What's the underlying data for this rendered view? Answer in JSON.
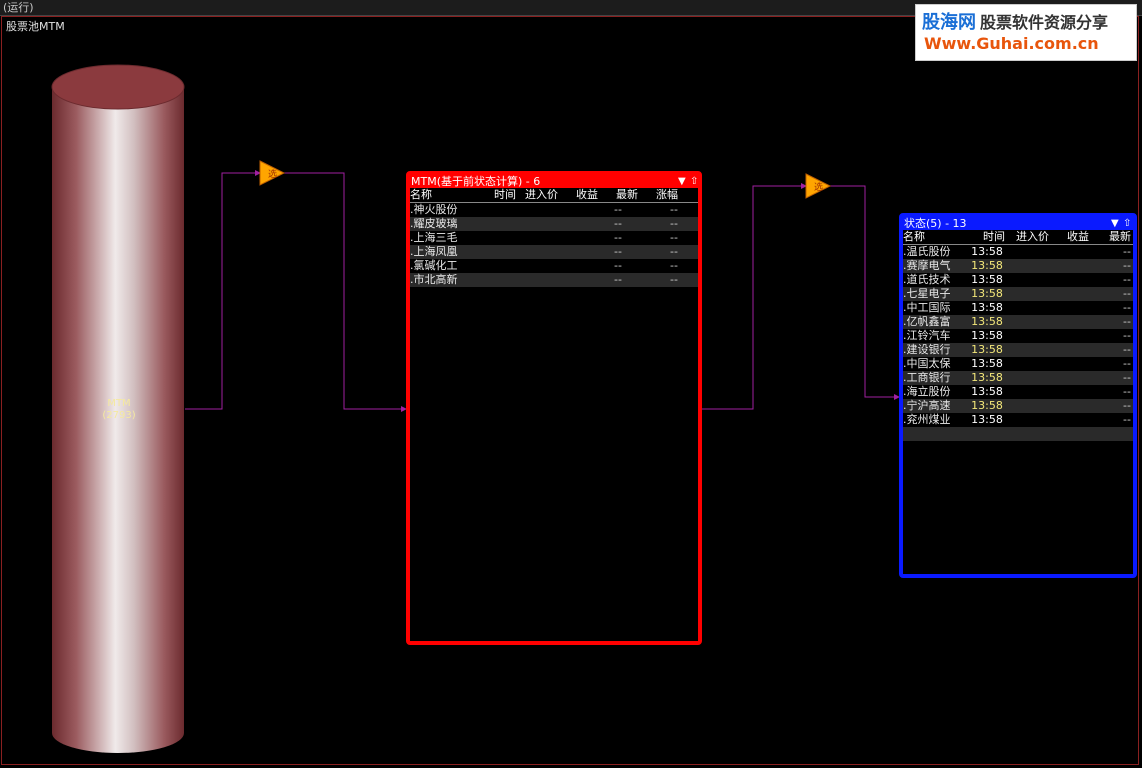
{
  "window": {
    "title": "(运行)"
  },
  "pool": {
    "label": "股票池MTM"
  },
  "logo": {
    "brand": "股海网",
    "slogan": "股票软件资源分享",
    "url": "Www.Guhai.com.cn"
  },
  "colors": {
    "red_panel": "#ff0000",
    "blue_panel": "#0a1aff",
    "wire": "#a020a0",
    "cylinder": "#8b3a3e",
    "filter_icon": "#ffa500"
  },
  "cylinder": {
    "name": "MTM",
    "count": "(2793)"
  },
  "filter_icon_text": "选",
  "panel_red": {
    "title": "MTM(基于前状态计算) - 6",
    "columns": [
      "名称",
      "时间",
      "进入价",
      "收益",
      "最新",
      "涨幅"
    ],
    "rows": [
      {
        "name": ".神火股份",
        "time": "",
        "price": "",
        "gain": "",
        "latest": "--",
        "change": "--"
      },
      {
        "name": ".耀皮玻璃",
        "time": "",
        "price": "",
        "gain": "",
        "latest": "--",
        "change": "--"
      },
      {
        "name": ".上海三毛",
        "time": "",
        "price": "",
        "gain": "",
        "latest": "--",
        "change": "--"
      },
      {
        "name": ".上海凤凰",
        "time": "",
        "price": "",
        "gain": "",
        "latest": "--",
        "change": "--"
      },
      {
        "name": ".氯碱化工",
        "time": "",
        "price": "",
        "gain": "",
        "latest": "--",
        "change": "--"
      },
      {
        "name": ".市北高新",
        "time": "",
        "price": "",
        "gain": "",
        "latest": "--",
        "change": "--"
      }
    ]
  },
  "panel_blue": {
    "title": "状态(5) - 13",
    "columns": [
      "名称",
      "时间",
      "进入价",
      "收益",
      "最新"
    ],
    "rows": [
      {
        "name": ".温氏股份",
        "time": "13:58",
        "price": "",
        "gain": "",
        "latest": "--"
      },
      {
        "name": ".赛摩电气",
        "time": "13:58",
        "price": "",
        "gain": "",
        "latest": "--"
      },
      {
        "name": ".道氏技术",
        "time": "13:58",
        "price": "",
        "gain": "",
        "latest": "--"
      },
      {
        "name": ".七星电子",
        "time": "13:58",
        "price": "",
        "gain": "",
        "latest": "--"
      },
      {
        "name": ".中工国际",
        "time": "13:58",
        "price": "",
        "gain": "",
        "latest": "--"
      },
      {
        "name": ".亿帆鑫富",
        "time": "13:58",
        "price": "",
        "gain": "",
        "latest": "--"
      },
      {
        "name": ".江铃汽车",
        "time": "13:58",
        "price": "",
        "gain": "",
        "latest": "--"
      },
      {
        "name": ".建设银行",
        "time": "13:58",
        "price": "",
        "gain": "",
        "latest": "--"
      },
      {
        "name": ".中国太保",
        "time": "13:58",
        "price": "",
        "gain": "",
        "latest": "--"
      },
      {
        "name": ".工商银行",
        "time": "13:58",
        "price": "",
        "gain": "",
        "latest": "--"
      },
      {
        "name": ".海立股份",
        "time": "13:58",
        "price": "",
        "gain": "",
        "latest": "--"
      },
      {
        "name": ".宁沪高速",
        "time": "13:58",
        "price": "",
        "gain": "",
        "latest": "--"
      },
      {
        "name": ".兖州煤业",
        "time": "13:58",
        "price": "",
        "gain": "",
        "latest": "--"
      }
    ]
  }
}
